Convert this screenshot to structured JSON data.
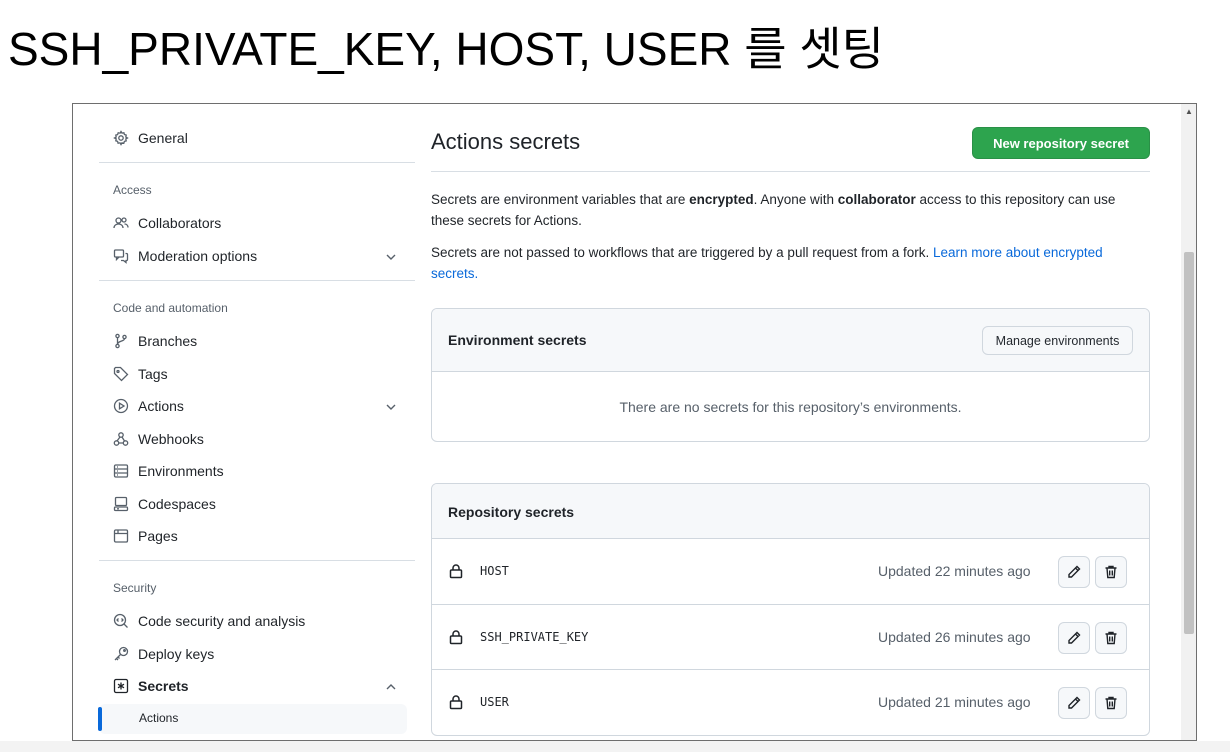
{
  "caption": "SSH_PRIVATE_KEY, HOST, USER 를 셋팅",
  "sidebar": {
    "general": "General",
    "sections": {
      "access": "Access",
      "code": "Code and automation",
      "security": "Security"
    },
    "items": {
      "collaborators": "Collaborators",
      "moderation": "Moderation options",
      "branches": "Branches",
      "tags": "Tags",
      "actions": "Actions",
      "webhooks": "Webhooks",
      "environments": "Environments",
      "codespaces": "Codespaces",
      "pages": "Pages",
      "code_security": "Code security and analysis",
      "deploy_keys": "Deploy keys",
      "secrets": "Secrets",
      "secrets_actions": "Actions"
    }
  },
  "main": {
    "title": "Actions secrets",
    "new_secret_button": "New repository secret",
    "para1": {
      "t1": "Secrets are environment variables that are ",
      "b1": "encrypted",
      "t2": ". Anyone with ",
      "b2": "collaborator",
      "t3": " access to this repository can use these secrets for Actions."
    },
    "para2": {
      "t1": "Secrets are not passed to workflows that are triggered by a pull request from a fork. ",
      "link": "Learn more about encrypted secrets",
      "t2": "."
    },
    "env_secrets": {
      "title": "Environment secrets",
      "manage_button": "Manage environments",
      "empty": "There are no secrets for this repository’s environments."
    },
    "repo_secrets": {
      "title": "Repository secrets",
      "rows": [
        {
          "name": "HOST",
          "updated": "Updated 22 minutes ago"
        },
        {
          "name": "SSH_PRIVATE_KEY",
          "updated": "Updated 26 minutes ago"
        },
        {
          "name": "USER",
          "updated": "Updated 21 minutes ago"
        }
      ]
    }
  },
  "colors": {
    "primary_button": "#2da44e",
    "link": "#0969da",
    "active_indicator": "#0969da"
  }
}
